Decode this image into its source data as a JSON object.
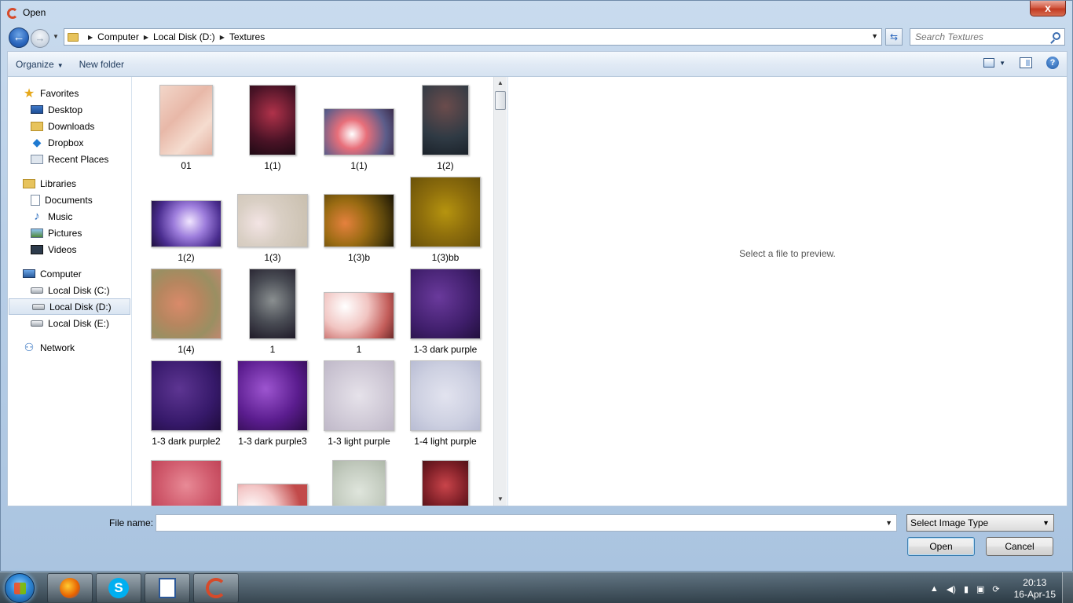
{
  "window": {
    "title": "Open",
    "close_label": "x"
  },
  "address": {
    "breadcrumbs": [
      "Computer",
      "Local Disk (D:)",
      "Textures"
    ]
  },
  "search": {
    "placeholder": "Search Textures"
  },
  "toolbar": {
    "organize_label": "Organize",
    "new_folder_label": "New folder"
  },
  "sidebar": {
    "favorites": {
      "header": "Favorites",
      "items": [
        "Desktop",
        "Downloads",
        "Dropbox",
        "Recent Places"
      ]
    },
    "libraries": {
      "header": "Libraries",
      "items": [
        "Documents",
        "Music",
        "Pictures",
        "Videos"
      ]
    },
    "computer": {
      "header": "Computer",
      "items": [
        "Local Disk (C:)",
        "Local Disk (D:)",
        "Local Disk (E:)"
      ],
      "selected": "Local Disk (D:)"
    },
    "network": {
      "header": "Network"
    }
  },
  "files": [
    {
      "name": "01"
    },
    {
      "name": "1(1)"
    },
    {
      "name": "1(1)"
    },
    {
      "name": "1(2)"
    },
    {
      "name": "1(2)"
    },
    {
      "name": "1(3)"
    },
    {
      "name": "1(3)b"
    },
    {
      "name": "1(3)bb"
    },
    {
      "name": "1(4)"
    },
    {
      "name": "1"
    },
    {
      "name": "1"
    },
    {
      "name": "1-3 dark purple"
    },
    {
      "name": "1-3 dark purple2"
    },
    {
      "name": "1-3 dark purple3"
    },
    {
      "name": "1-3 light purple"
    },
    {
      "name": "1-4 light purple"
    },
    {
      "name": ""
    },
    {
      "name": ""
    },
    {
      "name": ""
    },
    {
      "name": ""
    }
  ],
  "preview": {
    "message": "Select a file to preview."
  },
  "bottom": {
    "file_name_label": "File name:",
    "file_name_value": "",
    "file_type_selected": "Select Image Type",
    "open_label": "Open",
    "cancel_label": "Cancel"
  },
  "taskbar": {
    "apps": [
      "firefox",
      "skype",
      "document",
      "image-app"
    ],
    "clock_time": "20:13",
    "clock_date": "16-Apr-15"
  },
  "colors": {
    "accent": "#2a66bd",
    "selection": "#d9e5f2"
  }
}
